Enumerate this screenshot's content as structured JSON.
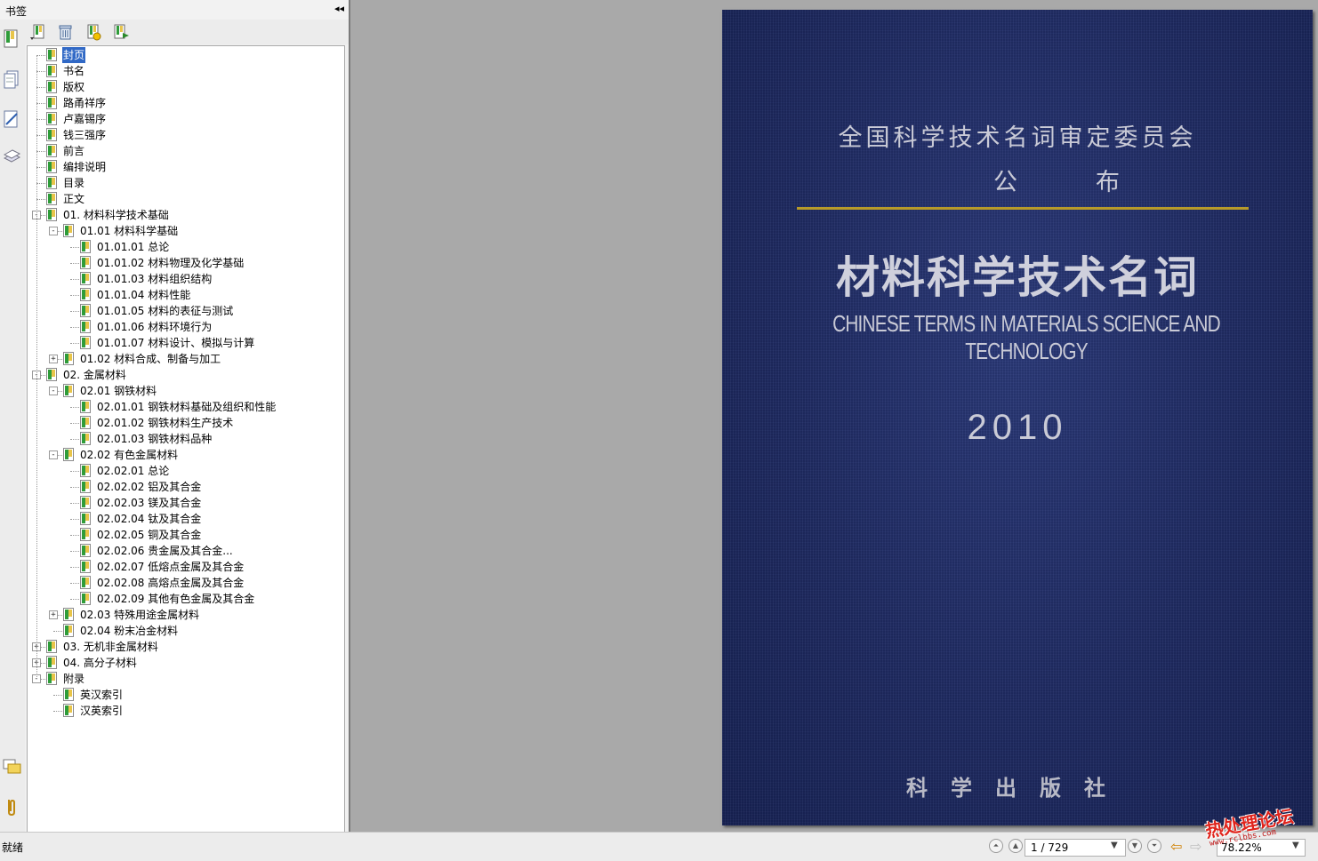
{
  "bookmark_panel": {
    "title": "书签",
    "collapse_glyph": "◂◂",
    "toolbar": {
      "options_icon": "bookmark-options-icon",
      "delete_icon": "trash-icon",
      "new_icon": "new-bookmark-icon",
      "expand_icon": "expand-bookmark-icon"
    },
    "rail_icons": [
      "bookmarks-icon",
      "pages-icon",
      "signatures-icon",
      "layers-icon",
      "comments-icon",
      "attachments-icon"
    ],
    "tree": [
      {
        "label": "封页",
        "level": 0,
        "toggle": "",
        "selected": true
      },
      {
        "label": "书名",
        "level": 0,
        "toggle": ""
      },
      {
        "label": "版权",
        "level": 0,
        "toggle": ""
      },
      {
        "label": "路甬祥序",
        "level": 0,
        "toggle": ""
      },
      {
        "label": "卢嘉锡序",
        "level": 0,
        "toggle": ""
      },
      {
        "label": "钱三强序",
        "level": 0,
        "toggle": ""
      },
      {
        "label": "前言",
        "level": 0,
        "toggle": ""
      },
      {
        "label": "编排说明",
        "level": 0,
        "toggle": ""
      },
      {
        "label": "目录",
        "level": 0,
        "toggle": ""
      },
      {
        "label": "正文",
        "level": 0,
        "toggle": ""
      },
      {
        "label": "01. 材料科学技术基础",
        "level": 0,
        "toggle": "-"
      },
      {
        "label": "01.01 材料科学基础",
        "level": 1,
        "toggle": "-"
      },
      {
        "label": "01.01.01 总论",
        "level": 2,
        "toggle": ""
      },
      {
        "label": "01.01.02 材料物理及化学基础",
        "level": 2,
        "toggle": ""
      },
      {
        "label": "01.01.03 材料组织结构",
        "level": 2,
        "toggle": ""
      },
      {
        "label": "01.01.04 材料性能",
        "level": 2,
        "toggle": ""
      },
      {
        "label": "01.01.05 材料的表征与测试",
        "level": 2,
        "toggle": ""
      },
      {
        "label": "01.01.06 材料环境行为",
        "level": 2,
        "toggle": ""
      },
      {
        "label": "01.01.07 材料设计、模拟与计算",
        "level": 2,
        "toggle": ""
      },
      {
        "label": "01.02 材料合成、制备与加工",
        "level": 1,
        "toggle": "+"
      },
      {
        "label": "02. 金属材料",
        "level": 0,
        "toggle": "-"
      },
      {
        "label": "02.01 钢铁材料",
        "level": 1,
        "toggle": "-"
      },
      {
        "label": "02.01.01 钢铁材料基础及组织和性能",
        "level": 2,
        "toggle": ""
      },
      {
        "label": "02.01.02 钢铁材料生产技术",
        "level": 2,
        "toggle": ""
      },
      {
        "label": "02.01.03 钢铁材料品种",
        "level": 2,
        "toggle": ""
      },
      {
        "label": "02.02 有色金属材料",
        "level": 1,
        "toggle": "-"
      },
      {
        "label": "02.02.01 总论",
        "level": 2,
        "toggle": ""
      },
      {
        "label": "02.02.02 铝及其合金",
        "level": 2,
        "toggle": ""
      },
      {
        "label": "02.02.03 镁及其合金",
        "level": 2,
        "toggle": ""
      },
      {
        "label": "02.02.04 钛及其合金",
        "level": 2,
        "toggle": ""
      },
      {
        "label": "02.02.05 铜及其合金",
        "level": 2,
        "toggle": ""
      },
      {
        "label": "02.02.06 贵金属及其合金...",
        "level": 2,
        "toggle": ""
      },
      {
        "label": "02.02.07 低熔点金属及其合金",
        "level": 2,
        "toggle": ""
      },
      {
        "label": "02.02.08 高熔点金属及其合金",
        "level": 2,
        "toggle": ""
      },
      {
        "label": "02.02.09 其他有色金属及其合金",
        "level": 2,
        "toggle": ""
      },
      {
        "label": "02.03 特殊用途金属材料",
        "level": 1,
        "toggle": "+"
      },
      {
        "label": "02.04 粉末冶金材料",
        "level": 1,
        "toggle": ""
      },
      {
        "label": "03. 无机非金属材料",
        "level": 0,
        "toggle": "+"
      },
      {
        "label": "04. 高分子材料",
        "level": 0,
        "toggle": "+"
      },
      {
        "label": "附录",
        "level": 0,
        "toggle": "-"
      },
      {
        "label": "英汉索引",
        "level": 1,
        "toggle": ""
      },
      {
        "label": "汉英索引",
        "level": 1,
        "toggle": ""
      }
    ]
  },
  "cover": {
    "committee": "全国科学技术名词审定委员会",
    "publish": "公布",
    "title": "材料科学技术名词",
    "english_title": "CHINESE TERMS IN MATERIALS SCIENCE AND TECHNOLOGY",
    "year": "2010",
    "publisher": "科学出版社",
    "background_color": "#1f2b63",
    "rule_color": "#b79a2a"
  },
  "status_bar": {
    "status_text": "就绪",
    "page_indicator": "1 / 729",
    "zoom": "78.22%",
    "watermark_main": "热处理论坛",
    "watermark_url": "www.rclbbs.com"
  }
}
